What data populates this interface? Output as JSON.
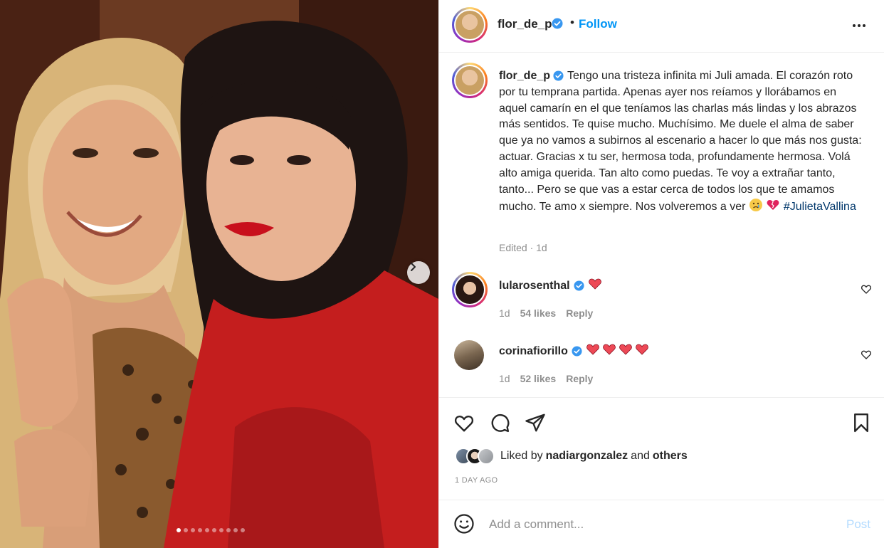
{
  "post": {
    "author": "flor_de_p",
    "follow_label": "Follow",
    "separator": "•",
    "caption": "Tengo una tristeza infinita mi Juli amada. El corazón roto por tu temprana partida. Apenas ayer nos reíamos y llorábamos en aquel camarín en el que teníamos las charlas más lindas y los abrazos más sentidos. Te quise mucho. Muchísimo. Me duele el alma de saber que ya no vamos a subirnos al escenario a hacer lo que más nos gusta: actuar. Gracias x tu ser, hermosa toda, profundamente hermosa. Volá alto amiga querida. Tan alto como puedas. Te voy a extrañar tanto, tanto... Pero se que vas a estar cerca de todos los que te amamos mucho. Te amo x siempre. Nos volveremos a ver",
    "hashtag": "#JulietaVallina",
    "edited": "Edited · 1d",
    "carousel": {
      "total": 10,
      "active": 0
    }
  },
  "comments": [
    {
      "user": "lularosenthal",
      "hearts": 1,
      "time": "1d",
      "likes": "54 likes",
      "reply": "Reply"
    },
    {
      "user": "corinafiorillo",
      "hearts": 4,
      "time": "1d",
      "likes": "52 likes",
      "reply": "Reply"
    }
  ],
  "engagement": {
    "liked_by_prefix": "Liked by",
    "liked_by_user": "nadiargonzalez",
    "liked_by_and": "and",
    "liked_by_others": "others",
    "time_ago": "1 DAY AGO"
  },
  "comment_box": {
    "placeholder": "Add a comment...",
    "post_label": "Post"
  },
  "icons": {
    "verified": "verified-badge-icon",
    "more": "more-options-icon",
    "like": "heart-icon",
    "comment": "comment-icon",
    "share": "share-icon",
    "save": "bookmark-icon",
    "emoji": "smile-icon",
    "next": "chevron-right-icon"
  },
  "colors": {
    "accent": "#0095f6",
    "verified": "#3897f0",
    "heart": "#ed4956",
    "muted": "#8e8e8e",
    "hashtag": "#00376b",
    "post_disabled": "#b3dbff"
  }
}
